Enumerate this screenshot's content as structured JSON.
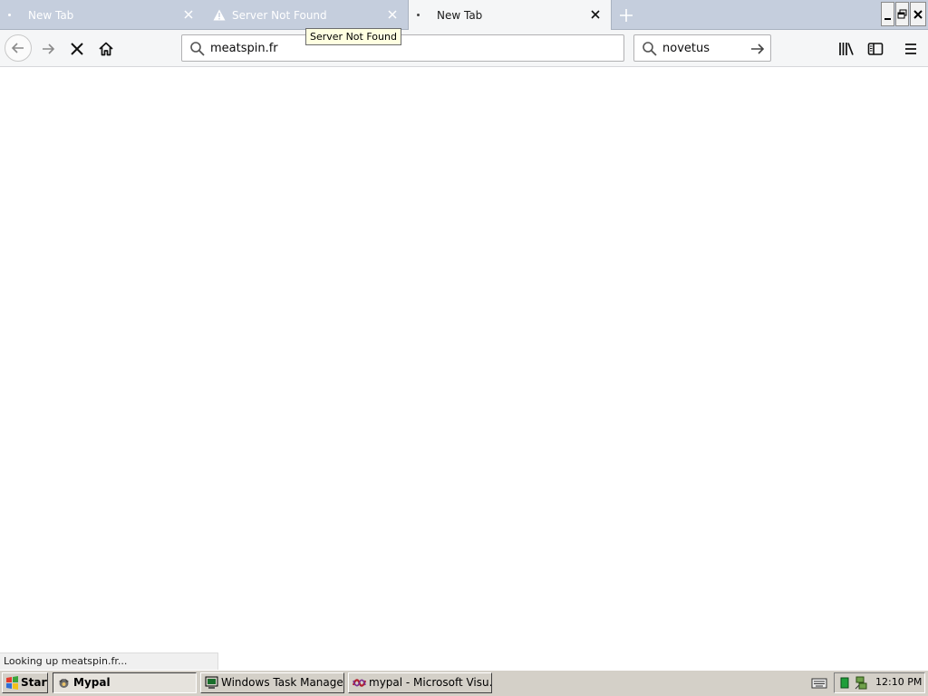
{
  "browser": {
    "tabs": [
      {
        "title": "New Tab",
        "state": "background"
      },
      {
        "title": "Server Not Found",
        "state": "background"
      },
      {
        "title": "New Tab",
        "state": "active"
      }
    ],
    "tooltip": "Server Not Found",
    "url": "meatspin.fr",
    "search": "novetus",
    "status": "Looking up meatspin.fr..."
  },
  "taskbar": {
    "start_label": "Start",
    "buttons": [
      {
        "label": "Mypal",
        "active": true
      },
      {
        "label": "Windows Task Manager",
        "active": false
      },
      {
        "label": "mypal - Microsoft Visu...",
        "active": false
      }
    ],
    "clock": "12:10 PM"
  },
  "colors": {
    "tabstrip": "#c5cedd",
    "toolbar": "#f5f6f7",
    "taskbar": "#d4d0c8",
    "tooltip": "#ffffe1"
  }
}
